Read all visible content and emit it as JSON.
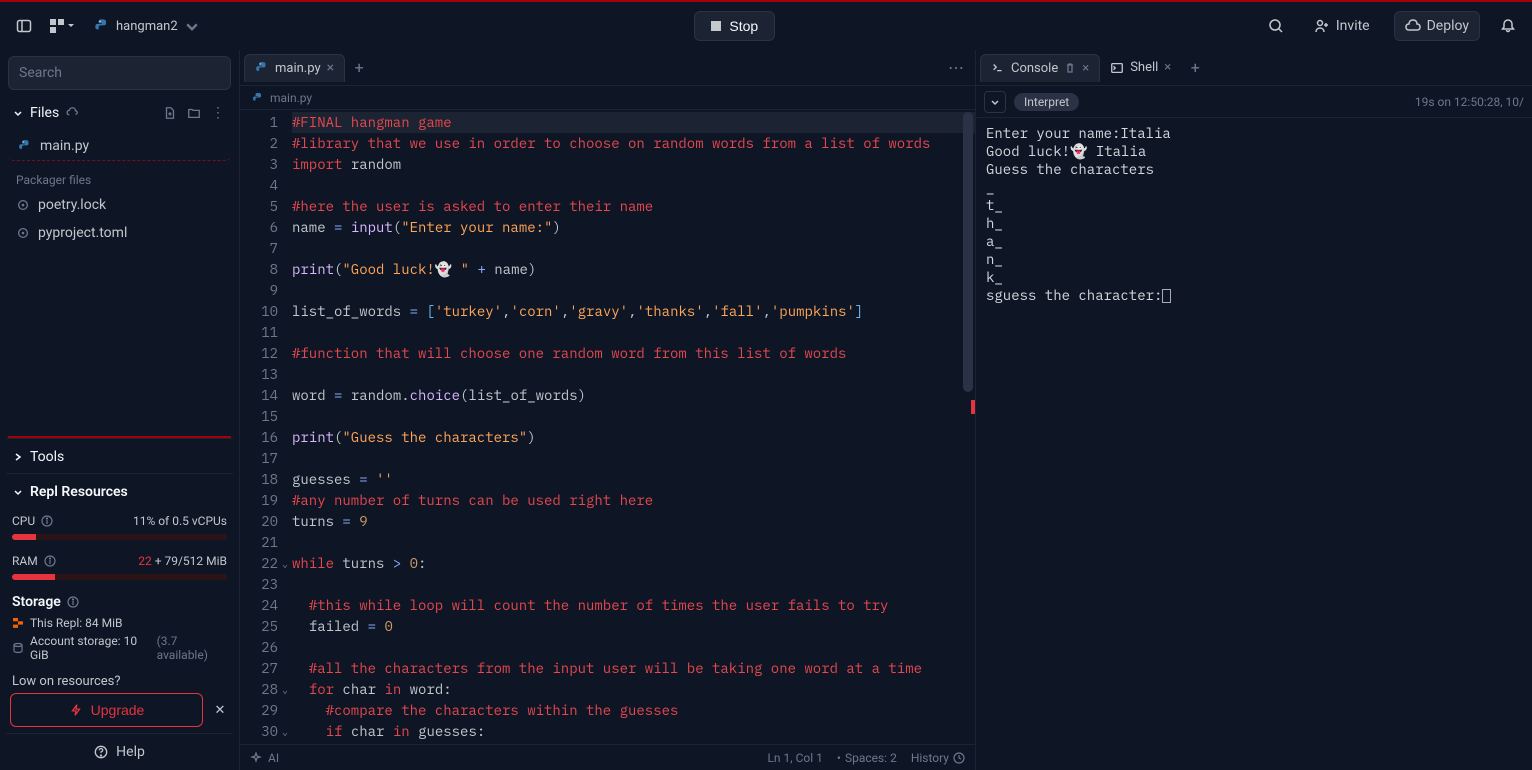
{
  "header": {
    "project_name": "hangman2",
    "run_label": "Stop",
    "invite_label": "Invite",
    "deploy_label": "Deploy"
  },
  "sidebar": {
    "search_placeholder": "Search",
    "files_label": "Files",
    "files": [
      "main.py"
    ],
    "packager_label": "Packager files",
    "packager_files": [
      "poetry.lock",
      "pyproject.toml"
    ],
    "tools_label": "Tools",
    "resources_label": "Repl Resources",
    "cpu_label": "CPU",
    "cpu_value": "11% of 0.5 vCPUs",
    "cpu_fill": 11,
    "ram_label": "RAM",
    "ram_val_a": "22",
    "ram_val_b": " + 79/512 MiB",
    "ram_fill": 20,
    "storage_label": "Storage",
    "storage_this": "This Repl: 84 MiB",
    "storage_acct": "Account storage: 10 GiB ",
    "storage_avail": "(3.7 available)",
    "low_label": "Low on resources?",
    "upgrade_label": "Upgrade",
    "help_label": "Help"
  },
  "editor": {
    "tab_label": "main.py",
    "breadcrumb": "main.py",
    "status_ai": "AI",
    "status_pos": "Ln 1, Col 1",
    "status_spaces": "Spaces: 2",
    "status_history": "History",
    "lines": [
      {
        "n": 1,
        "html": "<span class='hl-line'><span class='c-cm'>#FINAL hangman game</span></span>"
      },
      {
        "n": 2,
        "html": "<span class='c-cm'>#library that we use in order to choose on random words from a list of words</span>"
      },
      {
        "n": 3,
        "html": "<span class='c-kw'>import</span> <span class='c-id'>random</span>"
      },
      {
        "n": 4,
        "html": ""
      },
      {
        "n": 5,
        "html": "<span class='c-cm'>#here the user is asked to enter their name</span>"
      },
      {
        "n": 6,
        "html": "<span class='c-id'>name</span> <span class='c-op'>=</span> <span class='c-fn'>input</span>(<span class='c-str'>\"Enter your name:\"</span>)"
      },
      {
        "n": 7,
        "html": ""
      },
      {
        "n": 8,
        "html": "<span class='c-fn'>print</span>(<span class='c-str'>\"Good luck!👻 \"</span> <span class='c-op'>+</span> <span class='c-id'>name</span>)"
      },
      {
        "n": 9,
        "html": ""
      },
      {
        "n": 10,
        "html": "<span class='c-id'>list_of_words</span> <span class='c-op'>=</span> <span class='c-punc'>[</span><span class='c-str'>'turkey'</span>,<span class='c-str'>'corn'</span>,<span class='c-str'>'gravy'</span>,<span class='c-str'>'thanks'</span>,<span class='c-str'>'fall'</span>,<span class='c-str'>'pumpkins'</span><span class='c-punc'>]</span>"
      },
      {
        "n": 11,
        "html": ""
      },
      {
        "n": 12,
        "html": "<span class='c-cm'>#function that will choose one random word from this list of words</span>"
      },
      {
        "n": 13,
        "html": ""
      },
      {
        "n": 14,
        "html": "<span class='c-id'>word</span> <span class='c-op'>=</span> <span class='c-id'>random</span>.<span class='c-fn'>choice</span>(<span class='c-id'>list_of_words</span>)"
      },
      {
        "n": 15,
        "html": ""
      },
      {
        "n": 16,
        "html": "<span class='c-fn'>print</span>(<span class='c-str'>\"Guess the characters\"</span>)"
      },
      {
        "n": 17,
        "html": ""
      },
      {
        "n": 18,
        "html": "<span class='c-id'>guesses</span> <span class='c-op'>=</span> <span class='c-str'>''</span>"
      },
      {
        "n": 19,
        "html": "<span class='c-cm'>#any number of turns can be used right here</span>"
      },
      {
        "n": 20,
        "html": "<span class='c-id'>turns</span> <span class='c-op'>=</span> <span class='c-num'>9</span>"
      },
      {
        "n": 21,
        "html": ""
      },
      {
        "n": 22,
        "fold": true,
        "html": "<span class='c-kw'>while</span> <span class='c-id'>turns</span> <span class='c-op'>&gt;</span> <span class='c-num'>0</span>:"
      },
      {
        "n": 23,
        "html": ""
      },
      {
        "n": 24,
        "html": "  <span class='c-cm'>#this while loop will count the number of times the user fails to try</span>"
      },
      {
        "n": 25,
        "html": "  <span class='c-id'>failed</span> <span class='c-op'>=</span> <span class='c-num'>0</span>"
      },
      {
        "n": 26,
        "html": ""
      },
      {
        "n": 27,
        "html": "  <span class='c-cm'>#all the characters from the input user will be taking one word at a time</span>"
      },
      {
        "n": 28,
        "fold": true,
        "html": "  <span class='c-kw'>for</span> <span class='c-id'>char</span> <span class='c-kw'>in</span> <span class='c-id'>word</span>:"
      },
      {
        "n": 29,
        "html": "    <span class='c-cm'>#compare the characters within the guesses</span>"
      },
      {
        "n": 30,
        "fold": true,
        "html": "    <span class='c-kw'>if</span> <span class='c-id'>char</span> <span class='c-kw'>in</span> <span class='c-id'>guesses</span>:"
      }
    ]
  },
  "console": {
    "tab_console": "Console",
    "tab_shell": "Shell",
    "interpret_label": "Interpret",
    "time_label": "19s on 12:50:28, 10/",
    "output": "Enter your name:Italia\nGood luck!👻 Italia\nGuess the characters\n_\nt_\nh_\na_\nn_\nk_\nsguess the character:"
  }
}
